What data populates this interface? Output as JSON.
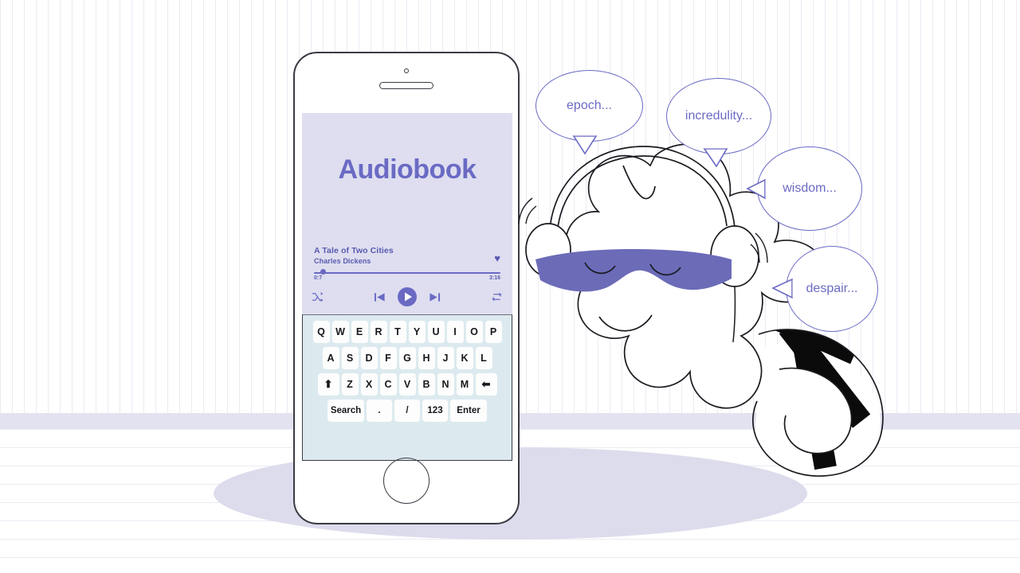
{
  "scene": {
    "title": "Audiobook app illustration",
    "background_color": "#ffffff",
    "accent_color": "#6a6ac4",
    "screen_bg_color": "#dedef0",
    "keyboard_bg_color": "#dceaef",
    "mask_color": "#6b6bb8",
    "ground_color": "#dcdcec"
  },
  "phone": {
    "camera_label": "front-camera",
    "speaker_label": "earpiece-speaker",
    "home_button_label": "home-button"
  },
  "player": {
    "app_title": "Audiobook",
    "track_title": "A Tale of Two Cities",
    "track_author": "Charles Dickens",
    "favorite_icon": "♥",
    "current_time": "0:7",
    "total_time": "3:16",
    "progress_percent": 5,
    "controls": {
      "shuffle": "shuffle-icon",
      "previous": "previous-track-icon",
      "play": "play-icon",
      "next": "next-track-icon",
      "repeat": "repeat-icon"
    }
  },
  "keyboard": {
    "row1": [
      "Q",
      "W",
      "E",
      "R",
      "T",
      "Y",
      "U",
      "I",
      "O",
      "P"
    ],
    "row2": [
      "A",
      "S",
      "D",
      "F",
      "G",
      "H",
      "J",
      "K",
      "L"
    ],
    "row3": [
      "⬆",
      "Z",
      "X",
      "C",
      "V",
      "B",
      "N",
      "M",
      "⬅"
    ],
    "row3_names": [
      "shift-key",
      "key-z",
      "key-x",
      "key-c",
      "key-v",
      "key-b",
      "key-n",
      "key-m",
      "backspace-key"
    ],
    "row4": [
      "Search",
      ".",
      "/",
      "123",
      "Enter"
    ],
    "row4_names": [
      "search-key",
      "period-key",
      "slash-key",
      "numbers-key",
      "enter-key"
    ]
  },
  "bubbles": [
    {
      "text": "epoch...",
      "name": "speech-bubble-epoch"
    },
    {
      "text": "incredulity...",
      "name": "speech-bubble-incredulity"
    },
    {
      "text": "wisdom...",
      "name": "speech-bubble-wisdom"
    },
    {
      "text": "despair...",
      "name": "speech-bubble-despair"
    }
  ],
  "character": {
    "name": "star-creature-listening",
    "wears": [
      "headphones",
      "sleep-mask",
      "striped-sock"
    ]
  }
}
